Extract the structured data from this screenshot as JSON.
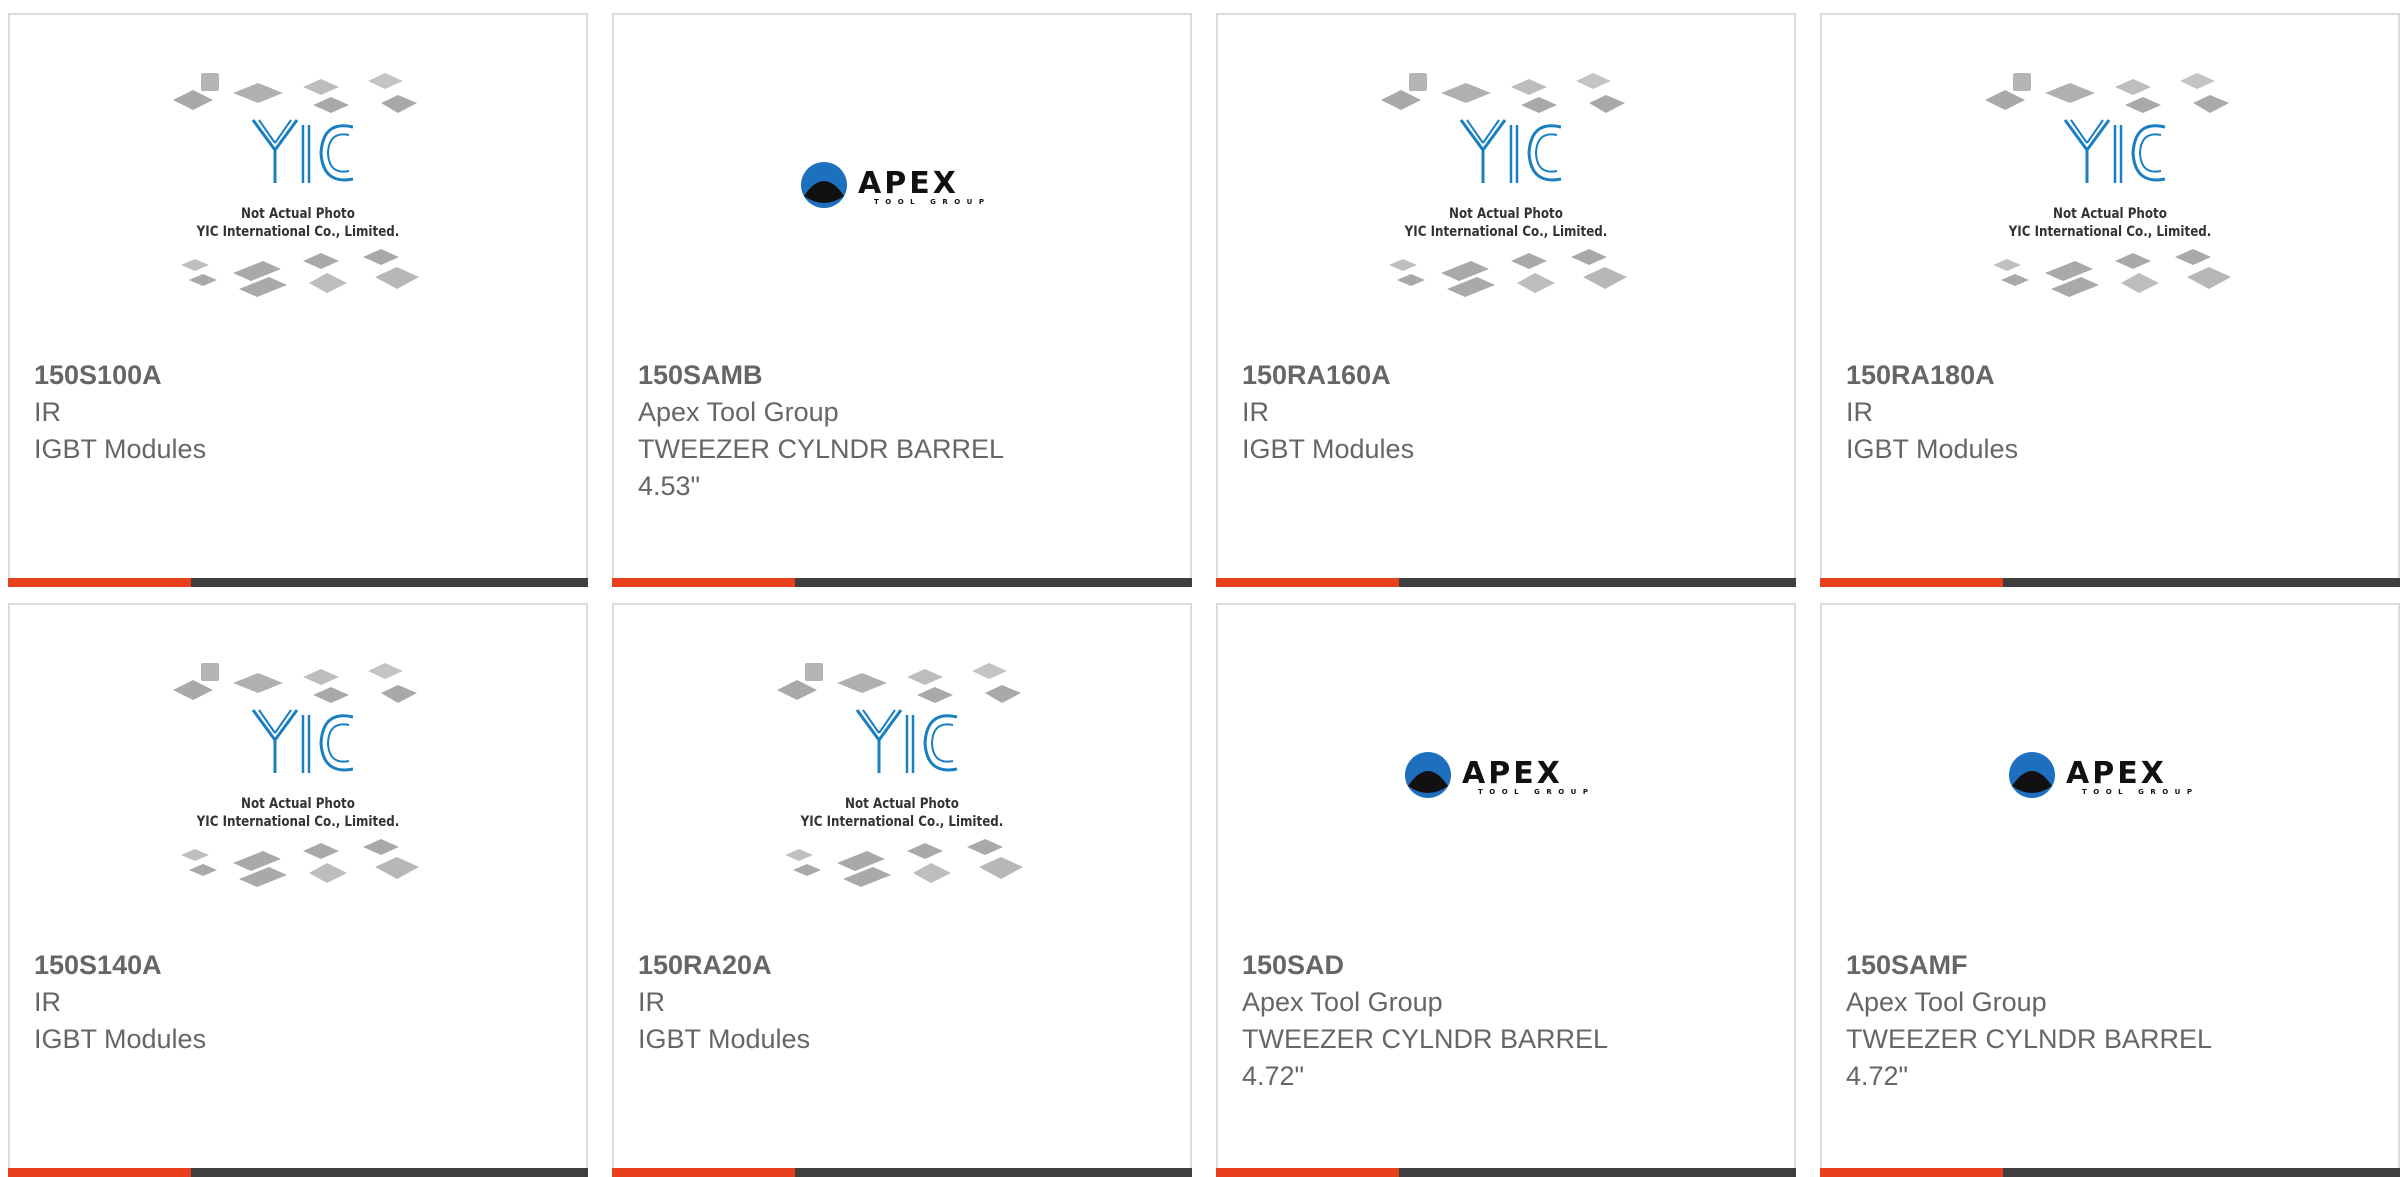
{
  "colors": {
    "accent": "#e8401c",
    "bar": "#3f3f3f",
    "border": "#dcdcdc",
    "text": "#666666",
    "yic_blue": "#1a7fc1"
  },
  "placeholder": {
    "brand": "YIC",
    "caption_line1": "Not Actual Photo",
    "caption_line2": "YIC International Co., Limited."
  },
  "apex_logo": {
    "word": "APEX",
    "tagline": "TOOL GROUP"
  },
  "products": [
    {
      "part": "150S100A",
      "brand": "IR",
      "desc": "IGBT Modules",
      "desc2": "",
      "image": "yic-placeholder"
    },
    {
      "part": "150SAMB",
      "brand": "Apex Tool Group",
      "desc": "TWEEZER CYLNDR BARREL",
      "desc2": "4.53\"",
      "image": "apex-logo"
    },
    {
      "part": "150RA160A",
      "brand": "IR",
      "desc": "IGBT Modules",
      "desc2": "",
      "image": "yic-placeholder"
    },
    {
      "part": "150RA180A",
      "brand": "IR",
      "desc": "IGBT Modules",
      "desc2": "",
      "image": "yic-placeholder"
    },
    {
      "part": "150S140A",
      "brand": "IR",
      "desc": "IGBT Modules",
      "desc2": "",
      "image": "yic-placeholder"
    },
    {
      "part": "150RA20A",
      "brand": "IR",
      "desc": "IGBT Modules",
      "desc2": "",
      "image": "yic-placeholder"
    },
    {
      "part": "150SAD",
      "brand": "Apex Tool Group",
      "desc": "TWEEZER CYLNDR BARREL",
      "desc2": "4.72\"",
      "image": "apex-logo"
    },
    {
      "part": "150SAMF",
      "brand": "Apex Tool Group",
      "desc": "TWEEZER CYLNDR BARREL",
      "desc2": "4.72\"",
      "image": "apex-logo"
    }
  ]
}
